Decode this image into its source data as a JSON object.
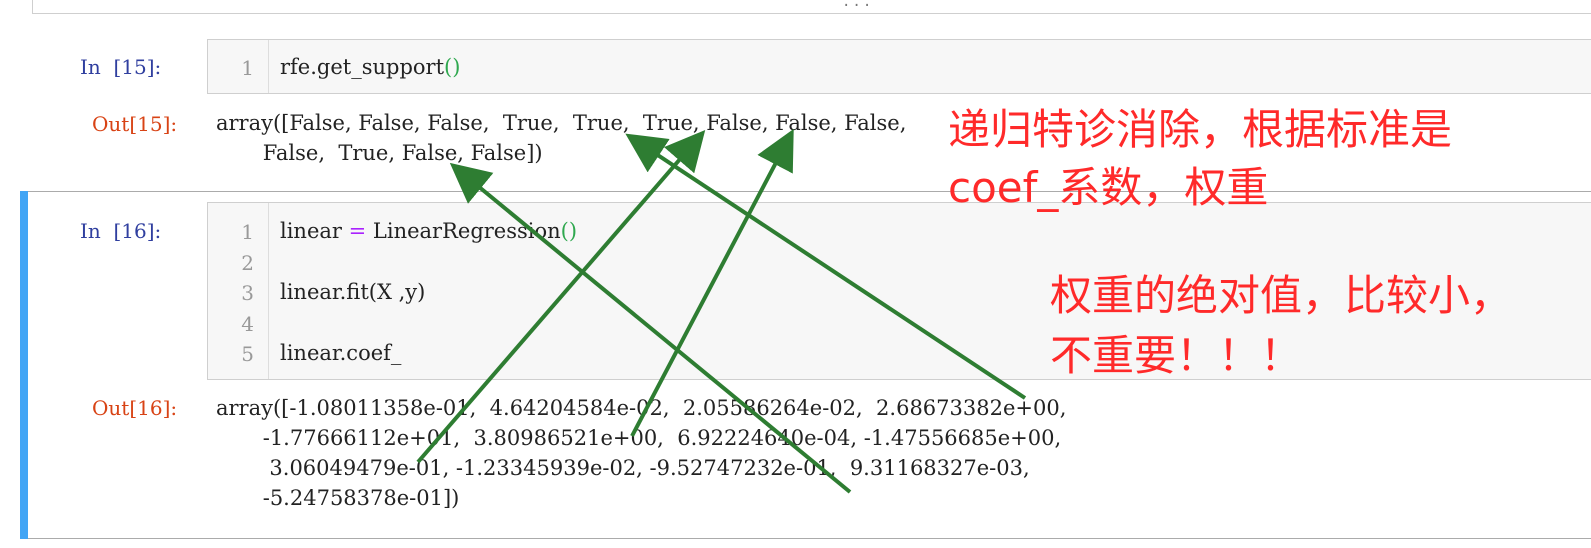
{
  "top_cell": {
    "ellipsis": "..."
  },
  "cell15": {
    "in_prompt": "In  [15]:",
    "line_numbers": [
      "1"
    ],
    "code": {
      "obj": "rfe.get_support",
      "open": "(",
      "close": ")"
    },
    "out_prompt": "Out[15]:",
    "output_lines": [
      "array([False, False, False,  True,  True,  True, False, False, False,",
      "       False,  True, False, False])"
    ]
  },
  "cell16": {
    "in_prompt": "In  [16]:",
    "line_numbers": [
      "1",
      "2",
      "3",
      "4",
      "5"
    ],
    "code": {
      "l1_var": "linear ",
      "l1_op": "=",
      "l1_rest": " LinearRegression",
      "l1_open": "(",
      "l1_close": ")",
      "l3": "linear.fit(X ,y)",
      "l5": "linear.coef_"
    },
    "out_prompt": "Out[16]:",
    "output_lines": [
      "array([-1.08011358e-01,  4.64204584e-02,  2.05586264e-02,  2.68673382e+00,",
      "       -1.77666112e+01,  3.80986521e+00,  6.92224640e-04, -1.47556685e+00,",
      "        3.06049479e-01, -1.23345939e-02, -9.52747232e-01,  9.31168327e-03,",
      "       -5.24758378e-01])"
    ]
  },
  "annotations": {
    "rfe_note_line1": "递归特诊消除，根据标准是",
    "rfe_note_line2": "coef_系数，权重",
    "weight_note_line1": "权重的绝对值，比较小，",
    "weight_note_line2": "不重要！！！"
  },
  "colors": {
    "prompt_in": "#303f9f",
    "prompt_out": "#d84315",
    "annotation": "#ff2a2a",
    "arrow": "#2e7d32",
    "selected_bar": "#42a5f5"
  }
}
